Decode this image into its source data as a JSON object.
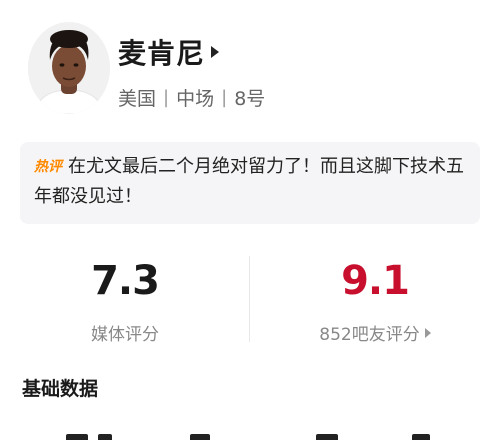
{
  "player": {
    "name": "麦肯尼",
    "country": "美国",
    "position": "中场",
    "number": "8号"
  },
  "comment": {
    "tag": "热评",
    "text": "在尤文最后二个月绝对留力了！而且这脚下技术五年都没见过！",
    "tag_color": "#ff8a00"
  },
  "ratings": {
    "media": {
      "value": "7.3",
      "label": "媒体评分"
    },
    "fans": {
      "value": "9.1",
      "label": "852吧友评分",
      "color": "#c8102e"
    }
  },
  "section": {
    "title": "基础数据"
  }
}
